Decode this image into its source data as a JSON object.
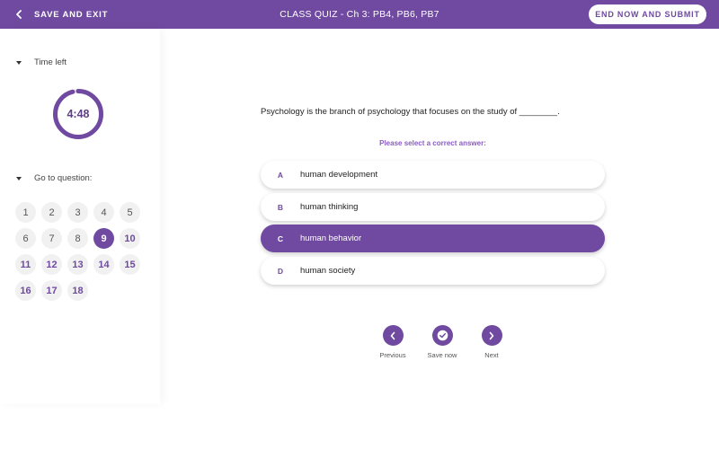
{
  "header": {
    "back_label": "SAVE AND EXIT",
    "title": "CLASS QUIZ - Ch 3: PB4, PB6, PB7",
    "end_label": "END NOW AND SUBMIT",
    "color": "#6f4aa0"
  },
  "sidebar": {
    "time_label": "Time left",
    "time_value": "4:48",
    "timer_fraction": 0.96,
    "goto_label": "Go to question:",
    "questions": [
      "1",
      "2",
      "3",
      "4",
      "5",
      "6",
      "7",
      "8",
      "9",
      "10",
      "11",
      "12",
      "13",
      "14",
      "15",
      "16",
      "17",
      "18"
    ],
    "current_question": "9"
  },
  "main": {
    "question": "Psychology is the branch of psychology that focuses on the study of  ________.",
    "prompt": "Please select a correct answer:",
    "options": [
      {
        "letter": "A",
        "text": "human development"
      },
      {
        "letter": "B",
        "text": "human thinking"
      },
      {
        "letter": "C",
        "text": "human behavior"
      },
      {
        "letter": "D",
        "text": "human society"
      }
    ],
    "selected_option": "C",
    "nav": {
      "previous": "Previous",
      "save": "Save now",
      "next": "Next"
    }
  },
  "icons": [
    "chevron-left-icon",
    "caret-down-icon",
    "check-icon",
    "chevron-right-icon"
  ]
}
